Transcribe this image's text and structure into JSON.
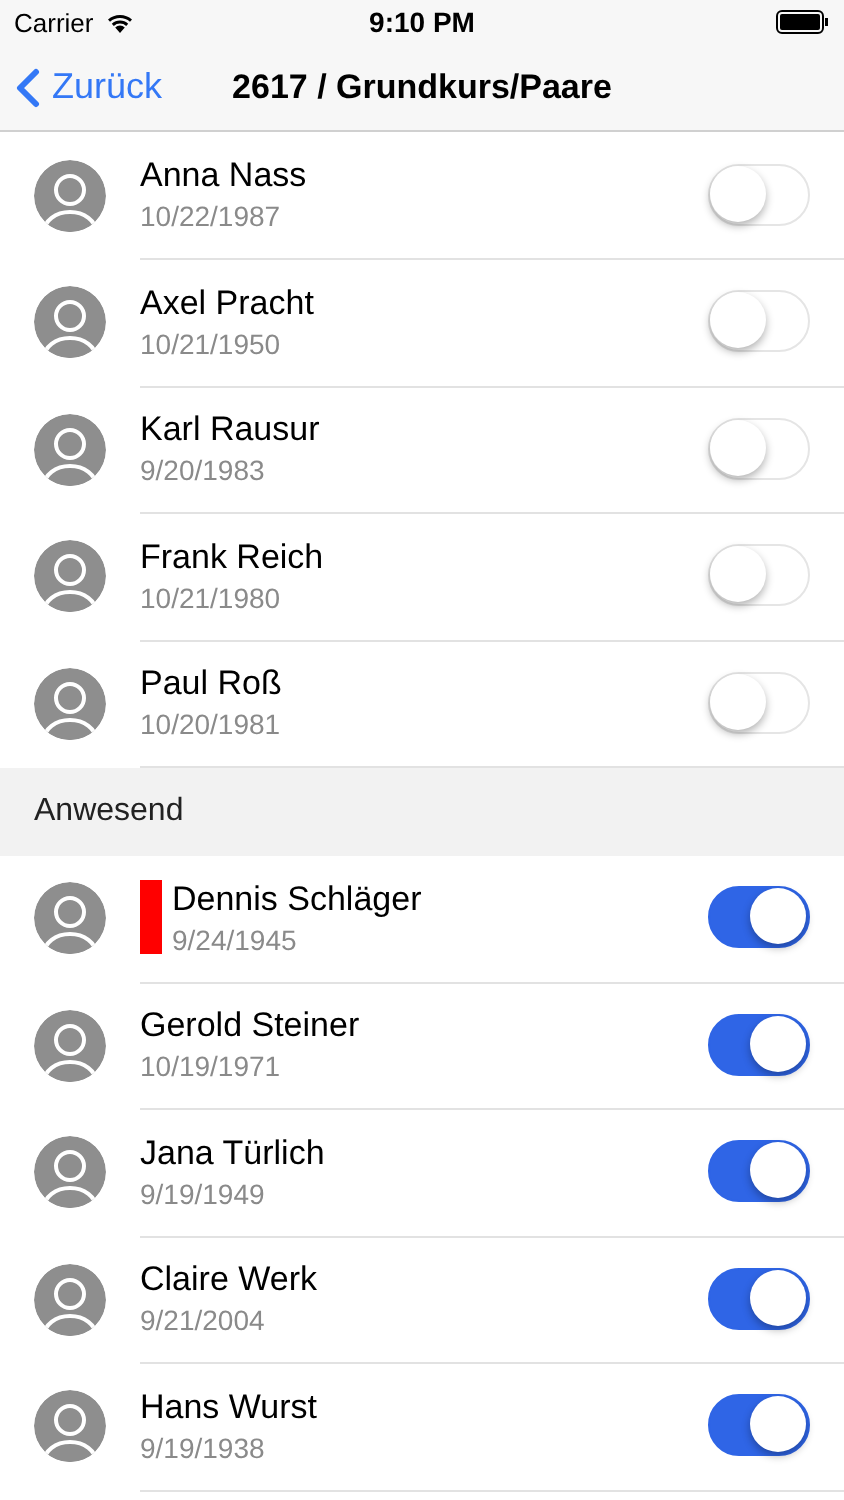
{
  "status_bar": {
    "carrier": "Carrier",
    "time": "9:10 PM"
  },
  "nav": {
    "back": "Zurück",
    "title": "2617 / Grundkurs/Paare"
  },
  "sections": [
    {
      "people": [
        {
          "name": "Anna Nass",
          "date": "10/22/1987",
          "flagged": false,
          "on": false
        },
        {
          "name": "Axel Pracht",
          "date": "10/21/1950",
          "flagged": false,
          "on": false
        },
        {
          "name": "Karl Rausur",
          "date": "9/20/1983",
          "flagged": false,
          "on": false
        },
        {
          "name": "Frank Reich",
          "date": "10/21/1980",
          "flagged": false,
          "on": false
        },
        {
          "name": "Paul Roß",
          "date": "10/20/1981",
          "flagged": false,
          "on": false
        }
      ]
    },
    {
      "header": "Anwesend",
      "people": [
        {
          "name": "Dennis Schläger",
          "date": "9/24/1945",
          "flagged": true,
          "on": true
        },
        {
          "name": "Gerold Steiner",
          "date": "10/19/1971",
          "flagged": false,
          "on": true
        },
        {
          "name": "Jana Türlich",
          "date": "9/19/1949",
          "flagged": false,
          "on": true
        },
        {
          "name": "Claire Werk",
          "date": "9/21/2004",
          "flagged": false,
          "on": true
        },
        {
          "name": "Hans Wurst",
          "date": "9/19/1938",
          "flagged": false,
          "on": true
        }
      ]
    }
  ]
}
